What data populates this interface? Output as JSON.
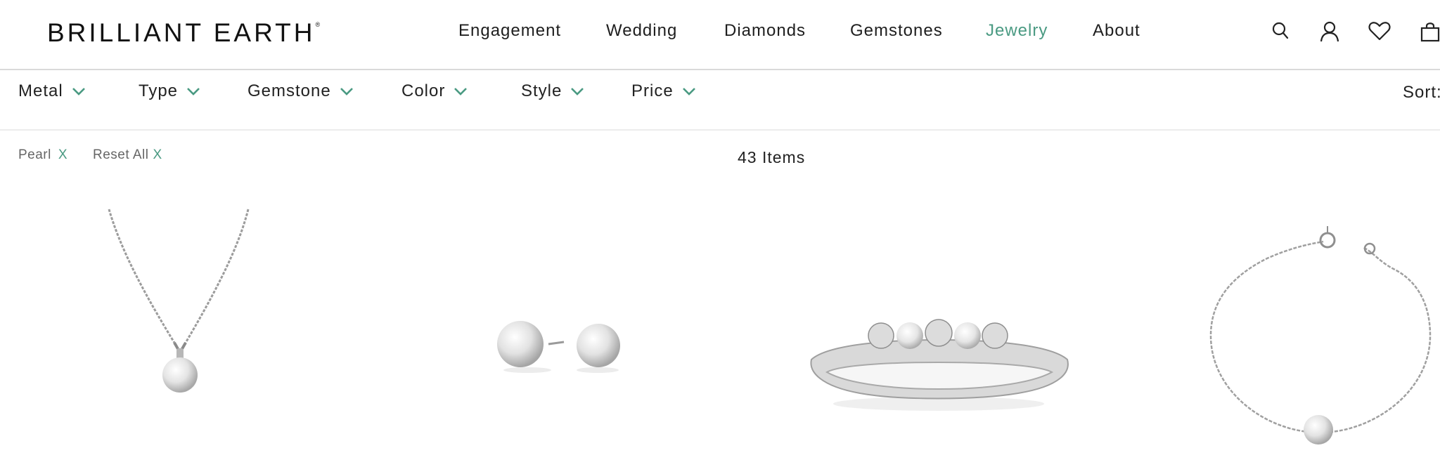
{
  "brand": {
    "name": "BRILLIANT EARTH",
    "mark": "®"
  },
  "nav": {
    "items": [
      {
        "label": "Engagement",
        "active": false
      },
      {
        "label": "Wedding",
        "active": false
      },
      {
        "label": "Diamonds",
        "active": false
      },
      {
        "label": "Gemstones",
        "active": false
      },
      {
        "label": "Jewelry",
        "active": true
      },
      {
        "label": "About",
        "active": false
      }
    ]
  },
  "header_icons": [
    "search-icon",
    "account-icon",
    "wishlist-heart-icon",
    "shopping-bag-icon"
  ],
  "filters": {
    "items": [
      "Metal",
      "Type",
      "Gemstone",
      "Color",
      "Style",
      "Price"
    ],
    "sort_label": "Sort:"
  },
  "active_filters": {
    "items": [
      "Pearl"
    ],
    "reset_label": "Reset All",
    "remove_glyph": "X"
  },
  "results": {
    "count_label": "43 Items"
  },
  "products": [
    "pearl-pendant-necklace",
    "pearl-stud-earrings",
    "pearl-and-diamond-ring",
    "pearl-chain-bracelet"
  ],
  "colors": {
    "accent": "#4a9a82",
    "text": "#1e1e1e",
    "muted": "#666666",
    "divider": "#d9d9d9"
  }
}
